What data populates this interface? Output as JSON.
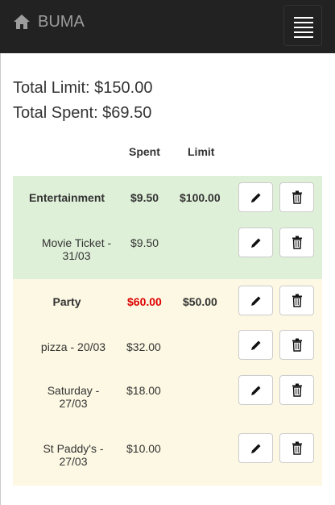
{
  "navbar": {
    "brand": "BUMA",
    "icons": {
      "brand": "home-icon",
      "toggle": "hamburger-menu-icon"
    }
  },
  "totals": {
    "limit": "Total Limit: $150.00",
    "spent": "Total Spent: $69.50"
  },
  "table": {
    "headers": {
      "spent": "Spent",
      "limit": "Limit"
    },
    "action_icons": {
      "edit": "pencil-icon",
      "delete": "trash-icon"
    },
    "colors": {
      "category_ok": "#dff0d8",
      "category_over": "#fcf8e3",
      "overspent_text": "#dd0000"
    },
    "categories": [
      {
        "name": "Entertainment",
        "spent": "$9.50",
        "limit": "$100.00",
        "over_budget": false,
        "items": [
          {
            "name_line1": "Movie Ticket -",
            "name_line2": "31/03",
            "spent": "$9.50"
          }
        ]
      },
      {
        "name": "Party",
        "spent": "$60.00",
        "limit": "$50.00",
        "over_budget": true,
        "items": [
          {
            "name_line1": "pizza - 20/03",
            "name_line2": "",
            "spent": "$32.00"
          },
          {
            "name_line1": "Saturday -",
            "name_line2": "27/03",
            "spent": "$18.00"
          },
          {
            "name_line1": "St Paddy's -",
            "name_line2": "27/03",
            "spent": "$10.00"
          }
        ]
      }
    ]
  }
}
